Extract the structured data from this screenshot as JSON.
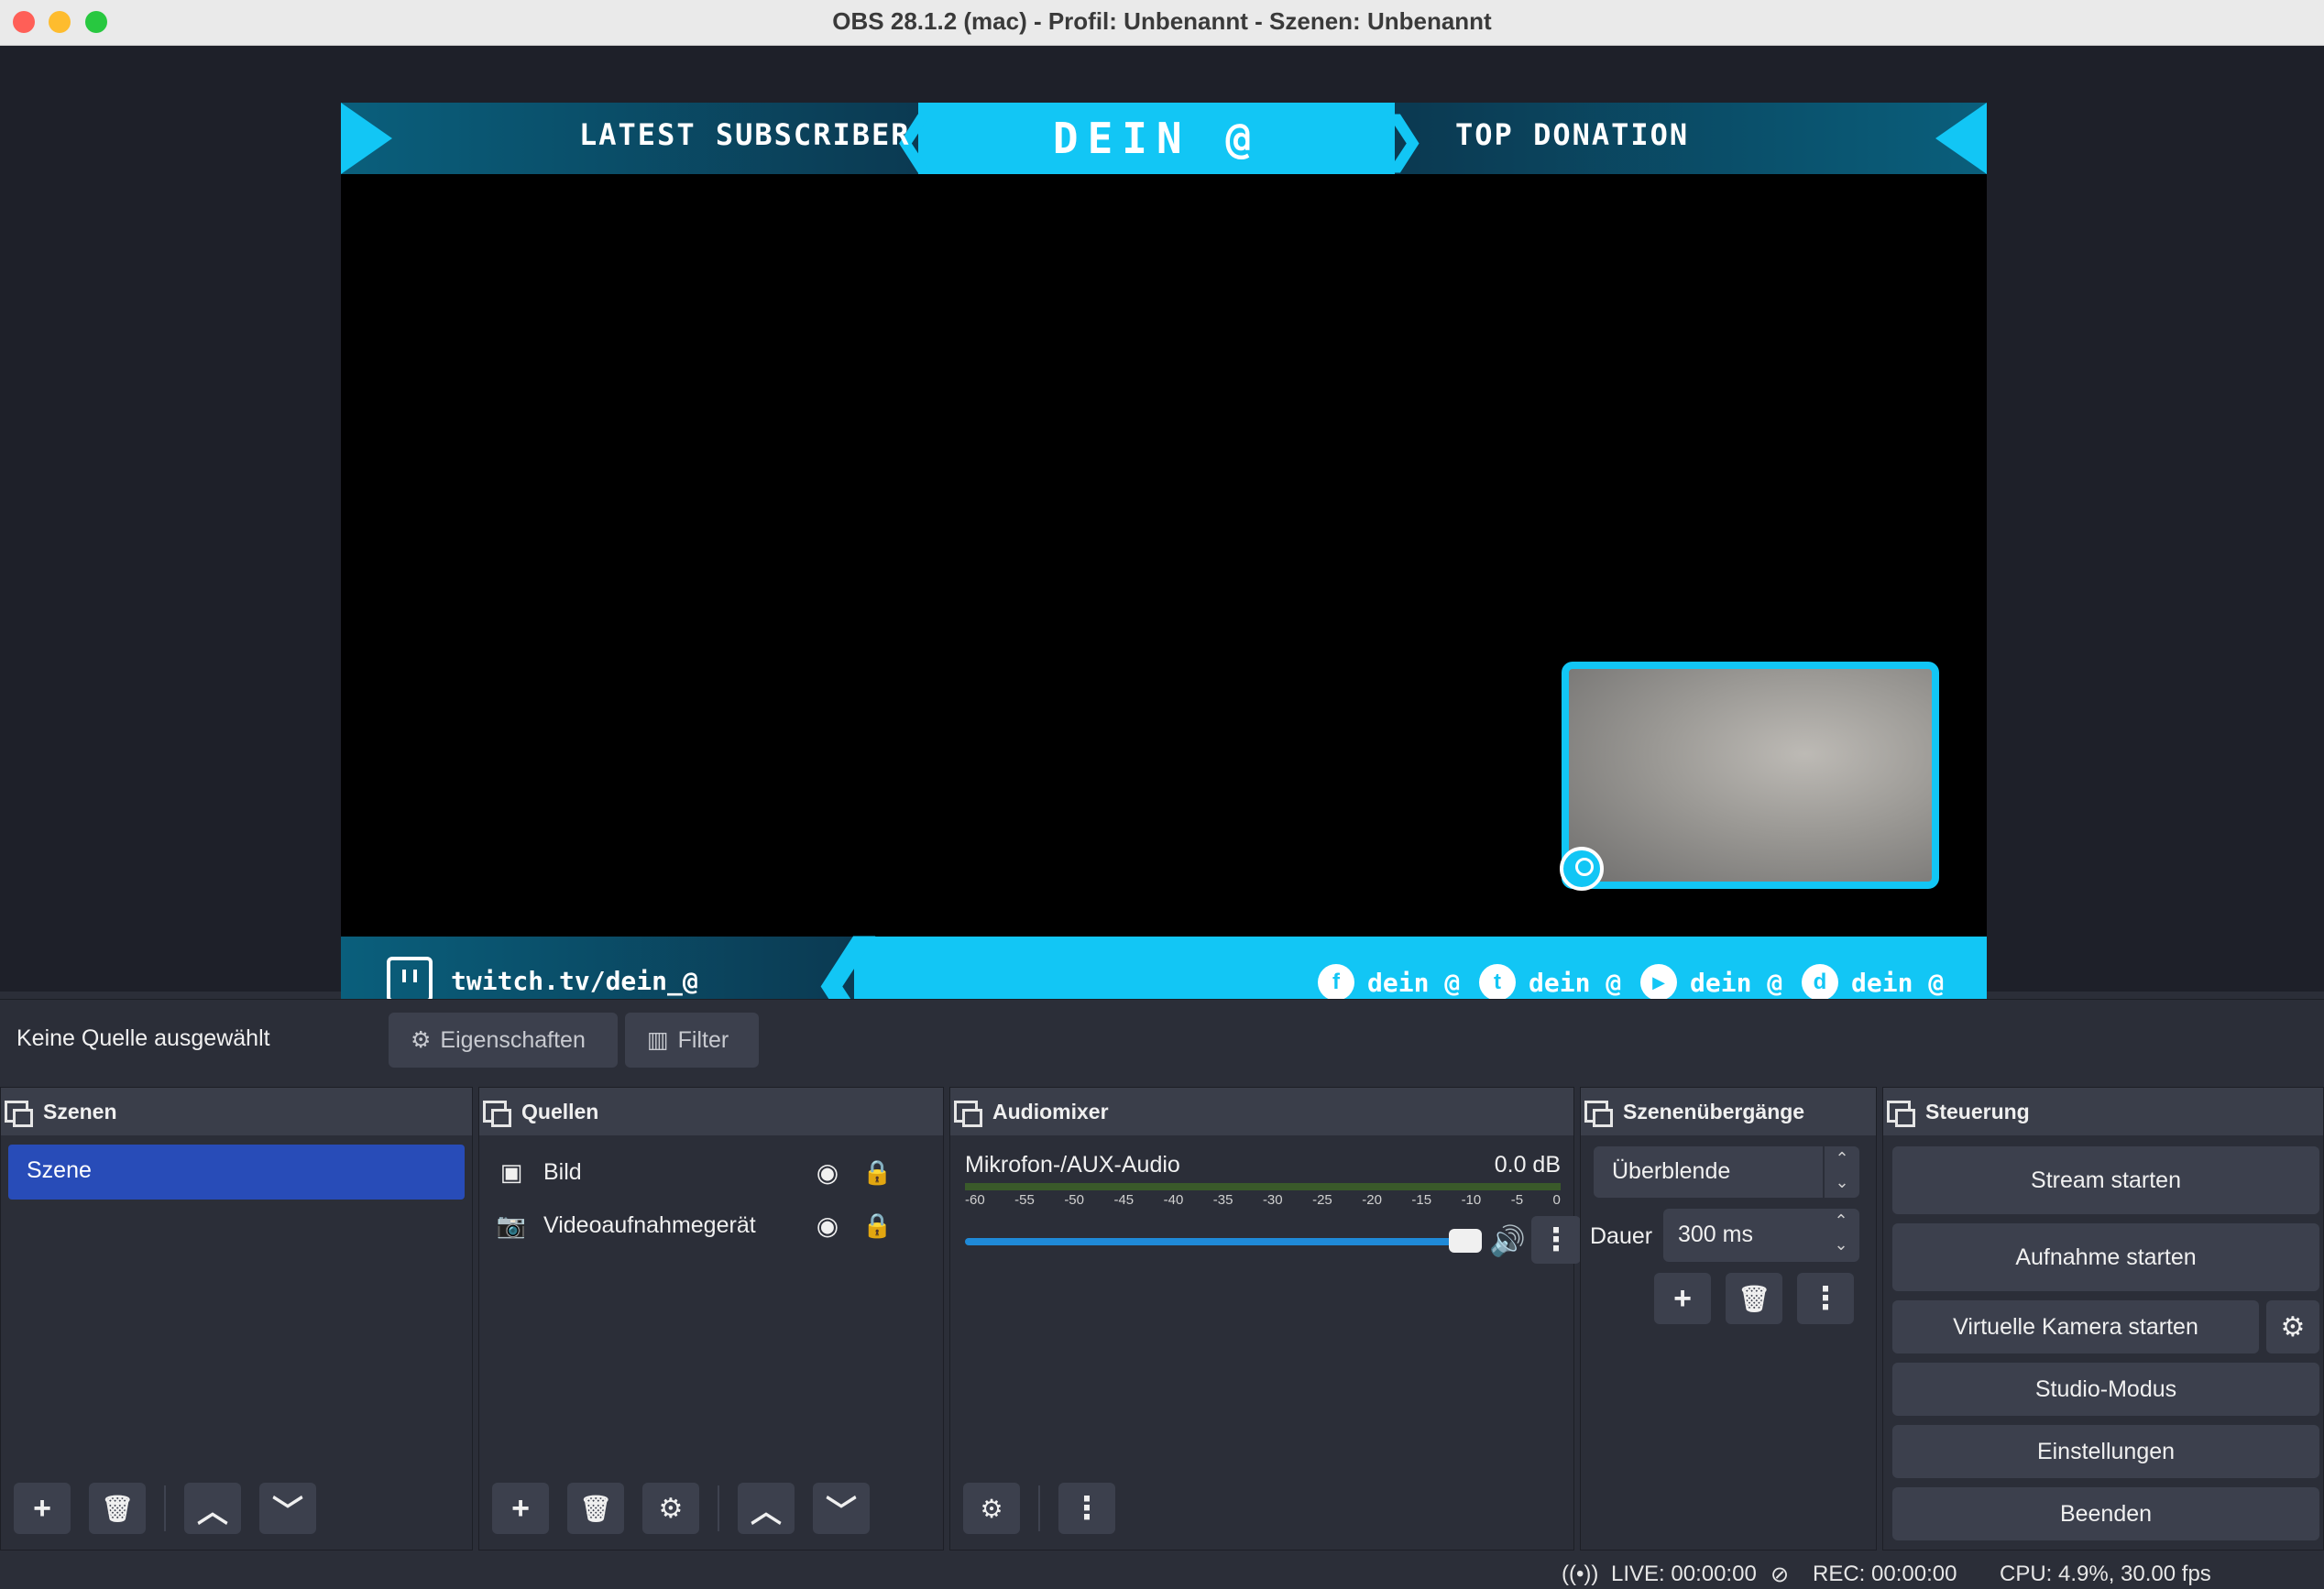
{
  "window": {
    "title": "OBS 28.1.2 (mac) - Profil: Unbenannt - Szenen: Unbenannt"
  },
  "overlay": {
    "top_left": "LATEST SUBSCRIBER",
    "top_center": "DEIN @",
    "top_right": "TOP DONATION",
    "twitch": "twitch.tv/dein_@",
    "socials": [
      {
        "icon": "facebook-icon",
        "glyph": "f",
        "text": "dein @"
      },
      {
        "icon": "twitter-icon",
        "glyph": "t",
        "text": "dein @"
      },
      {
        "icon": "youtube-icon",
        "glyph": "▶",
        "text": "dein @"
      },
      {
        "icon": "discord-icon",
        "glyph": "d",
        "text": "dein @"
      }
    ]
  },
  "context": {
    "label": "Keine Quelle ausgewählt",
    "properties": "Eigenschaften",
    "filter": "Filter"
  },
  "scenes": {
    "title": "Szenen",
    "items": [
      "Szene"
    ]
  },
  "sources": {
    "title": "Quellen",
    "items": [
      {
        "name": "Bild",
        "icon": "image-icon"
      },
      {
        "name": "Videoaufnahmegerät",
        "icon": "camera-icon"
      }
    ]
  },
  "mixer": {
    "title": "Audiomixer",
    "channel": "Mikrofon-/AUX-Audio",
    "db": "0.0 dB",
    "ticks": [
      "-60",
      "-55",
      "-50",
      "-45",
      "-40",
      "-35",
      "-30",
      "-25",
      "-20",
      "-15",
      "-10",
      "-5",
      "0"
    ],
    "volume_level": 0.95
  },
  "transitions": {
    "title": "Szenenübergänge",
    "selected": "Überblende",
    "duration_label": "Dauer",
    "duration_value": "300 ms"
  },
  "controls": {
    "title": "Steuerung",
    "stream": "Stream starten",
    "record": "Aufnahme starten",
    "virtualcam": "Virtuelle Kamera starten",
    "studio": "Studio-Modus",
    "settings": "Einstellungen",
    "exit": "Beenden"
  },
  "status": {
    "live": "LIVE: 00:00:00",
    "rec": "REC: 00:00:00",
    "cpu": "CPU: 4.9%, 30.00 fps"
  },
  "colors": {
    "accent": "#12c6f5",
    "selection": "#284cb8",
    "panel": "#2b2e38"
  }
}
